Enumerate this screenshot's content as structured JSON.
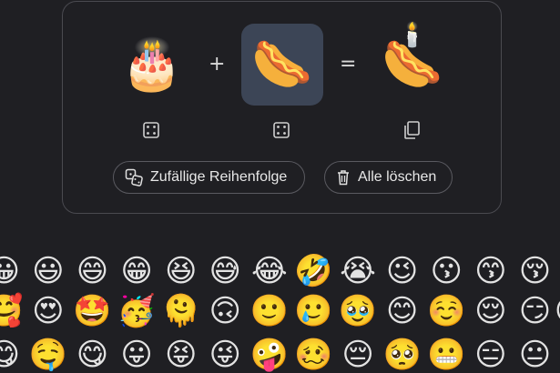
{
  "kitchen": {
    "left_emoji": "🎂",
    "middle_emoji": "🌭",
    "result_base": "🌭",
    "result_topper": "🕯️",
    "plus_symbol": "+",
    "equals_symbol": "=",
    "random_label": "Zufällige Reihenfolge",
    "clear_label": "Alle löschen"
  },
  "emoji_grid": {
    "rows": [
      [
        "😀",
        "😃",
        "😄",
        "😁",
        "😆",
        "😅",
        "😂",
        "🤣",
        "😭",
        "😉",
        "😗",
        "😙",
        "😚",
        "😘"
      ],
      [
        "🥰",
        "😍",
        "🤩",
        "🥳",
        "🫠",
        "🙃",
        "🙂",
        "🥲",
        "🥹",
        "😊",
        "☺️",
        "😌",
        "😏",
        "😴"
      ],
      [
        "😋",
        "🤤",
        "😋",
        "😛",
        "😝",
        "😜",
        "🤪",
        "🥴",
        "😔",
        "🥺",
        "😬",
        "😑",
        "😐",
        "😶"
      ]
    ]
  },
  "colors": {
    "background": "#1f1f23",
    "selected_slot": "#3c4556",
    "card_border": "#4a4a50"
  }
}
